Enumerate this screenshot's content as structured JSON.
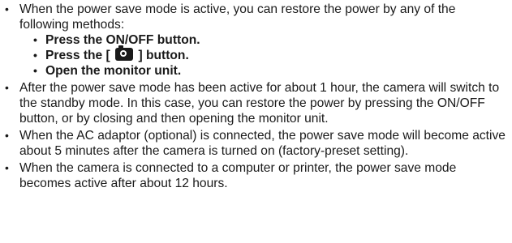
{
  "bullets": {
    "first": {
      "text": "When the power save mode is active, you can restore the power by any of the following methods:",
      "methods": [
        "Press the ON/OFF button.",
        "Open the monitor unit."
      ],
      "shooting_method": {
        "prefix": "Press the [",
        "suffix": "] button.",
        "icon": "camera-icon"
      }
    },
    "second": "After the power save mode has been active for about 1 hour, the camera will switch to the standby mode. In this case, you can restore the power by pressing the ON/OFF button, or by closing and then opening the monitor unit.",
    "third": "When the AC adaptor (optional) is connected, the power save mode will become active about 5 minutes after the camera is turned on (factory-preset setting).",
    "fourth": "When the camera is connected to a computer or printer, the power save mode becomes active after about 12 hours."
  },
  "bullet_symbol": "•"
}
